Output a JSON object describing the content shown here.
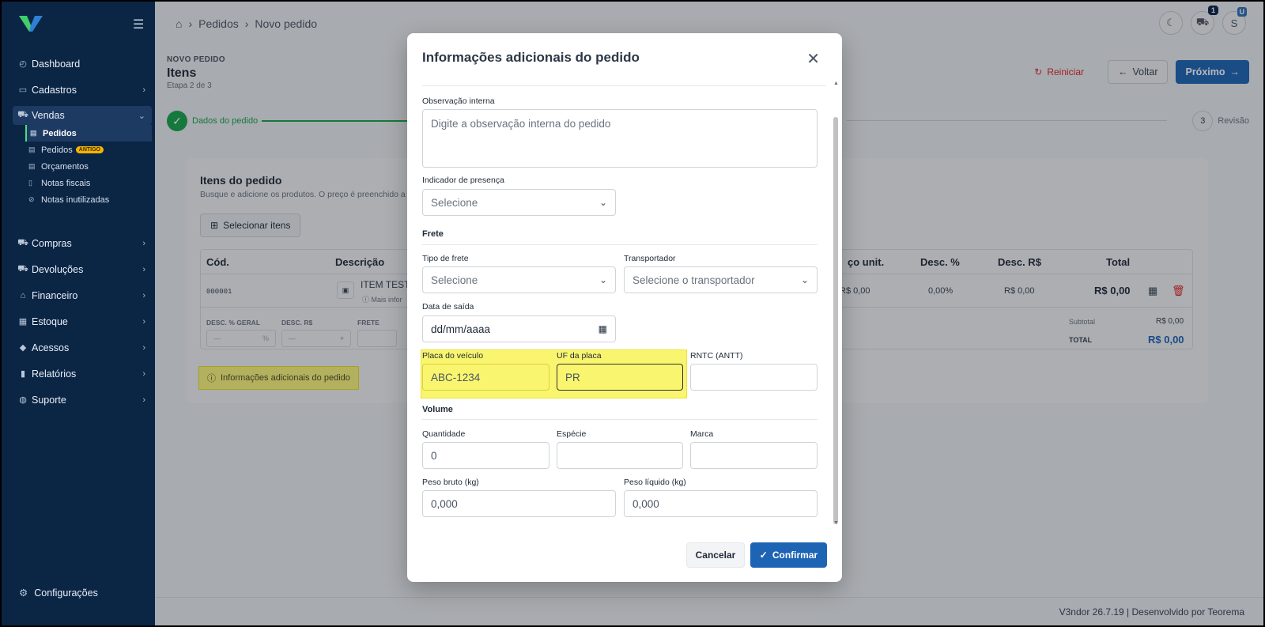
{
  "breadcrumb": {
    "home": "⌂",
    "items": [
      "Pedidos",
      "Novo pedido"
    ]
  },
  "sidebar": {
    "items": [
      {
        "label": "Dashboard",
        "icon": "dashboard-icon",
        "glyph": "◴",
        "chevron": false
      },
      {
        "label": "Cadastros",
        "icon": "id-card-icon",
        "glyph": "▭",
        "chevron": true
      },
      {
        "label": "Vendas",
        "icon": "cart-icon",
        "glyph": "🛒",
        "chevron": true,
        "active": true
      }
    ],
    "vendas_sub": [
      {
        "label": "Pedidos",
        "active": true
      },
      {
        "label": "Pedidos",
        "badge": "ANTIGO"
      },
      {
        "label": "Orçamentos"
      },
      {
        "label": "Notas fiscais"
      },
      {
        "label": "Notas inutilizadas"
      }
    ],
    "items2": [
      {
        "label": "Compras",
        "icon": "cart-icon",
        "glyph": "🛒"
      },
      {
        "label": "Devoluções",
        "icon": "cart-icon",
        "glyph": "🛒"
      },
      {
        "label": "Financeiro",
        "icon": "bank-icon",
        "glyph": "🏛"
      },
      {
        "label": "Estoque",
        "icon": "box-icon",
        "glyph": "▦"
      },
      {
        "label": "Acessos",
        "icon": "shield-icon",
        "glyph": "⛉"
      },
      {
        "label": "Relatórios",
        "icon": "bar-chart-icon",
        "glyph": "▮"
      },
      {
        "label": "Suporte",
        "icon": "lifebuoy-icon",
        "glyph": "◍"
      }
    ],
    "config": "Configurações"
  },
  "top": {
    "cart_count": "1",
    "user_initial": "S",
    "user_badge": "U"
  },
  "page": {
    "pre": "NOVO PEDIDO",
    "title": "Itens",
    "step": "Etapa 2 de 3",
    "reset": "Reiniciar",
    "back": "Voltar",
    "next": "Próximo",
    "step1": "Dados do pedido",
    "step3_num": "3",
    "step3": "Revisão"
  },
  "card": {
    "title": "Itens do pedido",
    "subtitle": "Busque e adicione os produtos. O preço é preenchido a",
    "select_btn": "Selecionar itens",
    "headers": [
      "Cód.",
      "Descrição",
      "ço unit.",
      "Desc. %",
      "Desc. R$",
      "Total"
    ],
    "row": {
      "code": "000001",
      "desc": "ITEM TEST",
      "more": "Mais infor",
      "unit": "R$ 0,00",
      "pct": "0,00%",
      "descr": "R$ 0,00",
      "total": "R$ 0,00"
    },
    "mini_labels": [
      "DESC. % GERAL",
      "DESC. R$",
      "FRETE"
    ],
    "mini_values": [
      "—",
      "%",
      "—"
    ],
    "subtotal_label": "Subtotal",
    "subtotal_value": "R$ 0,00",
    "total_label": "TOTAL",
    "total_value": "R$ 0,00",
    "info_link": "Informações adicionais do pedido"
  },
  "footer": {
    "text": "V3ndor  26.7.19  |  Desenvolvido por Teorema"
  },
  "modal": {
    "title": "Informações adicionais do pedido",
    "obs_label": "Observação interna",
    "obs_placeholder": "Digite a observação interna do pedido",
    "presenca_label": "Indicador de presença",
    "presenca_value": "Selecione",
    "frete_section": "Frete",
    "tipo_frete_label": "Tipo de frete",
    "tipo_frete_value": "Selecione",
    "transp_label": "Transportador",
    "transp_value": "Selecione o transportador",
    "data_label": "Data de saída",
    "data_placeholder": "dd/mm/aaaa",
    "placa_label": "Placa do veículo",
    "placa_value": "ABC-1234",
    "uf_label": "UF da placa",
    "uf_value": "PR",
    "rntc_label": "RNTC (ANTT)",
    "rntc_value": "",
    "volume_section": "Volume",
    "qtd_label": "Quantidade",
    "qtd_value": "0",
    "especie_label": "Espécie",
    "especie_value": "",
    "marca_label": "Marca",
    "marca_value": "",
    "peso_bruto_label": "Peso bruto (kg)",
    "peso_bruto_value": "0,000",
    "peso_liq_label": "Peso líquido (kg)",
    "peso_liq_value": "0,000",
    "cancel": "Cancelar",
    "confirm": "Confirmar"
  },
  "colors": {
    "sidebar": "#0b2545",
    "primary": "#1e64b4",
    "success": "#16a34a",
    "danger": "#dc2626",
    "highlight": "#f9f56e"
  }
}
